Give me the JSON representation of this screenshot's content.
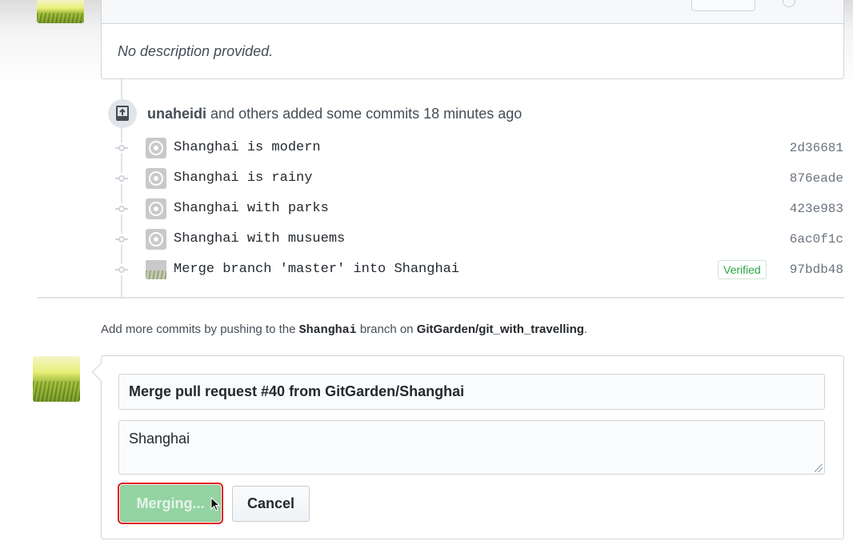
{
  "description": {
    "text": "No description provided."
  },
  "push_event": {
    "author": "unaheidi",
    "text": "and others added some commits 18 minutes ago"
  },
  "commits": [
    {
      "message": "Shanghai is modern",
      "sha": "2d36681",
      "verified": ""
    },
    {
      "message": "Shanghai is rainy",
      "sha": "876eade",
      "verified": ""
    },
    {
      "message": "Shanghai with parks",
      "sha": "423e983",
      "verified": ""
    },
    {
      "message": "Shanghai with musuems",
      "sha": "6ac0f1c",
      "verified": ""
    },
    {
      "message": "Merge branch 'master' into Shanghai",
      "sha": "97bdb48",
      "verified": "Verified"
    }
  ],
  "add_more": {
    "prefix": "Add more commits by pushing to the",
    "branch": "Shanghai",
    "middle": "branch on",
    "repo": "GitGarden/git_with_travelling",
    "suffix": "."
  },
  "merge_form": {
    "title_value": "Merge pull request #40 from GitGarden/Shanghai",
    "body_value": "Shanghai",
    "merging_label": "Merging...",
    "cancel_label": "Cancel"
  },
  "colors": {
    "merging_button": "#94d3a2",
    "verified_text": "#28a745",
    "highlight_outline": "#e01b1b"
  }
}
